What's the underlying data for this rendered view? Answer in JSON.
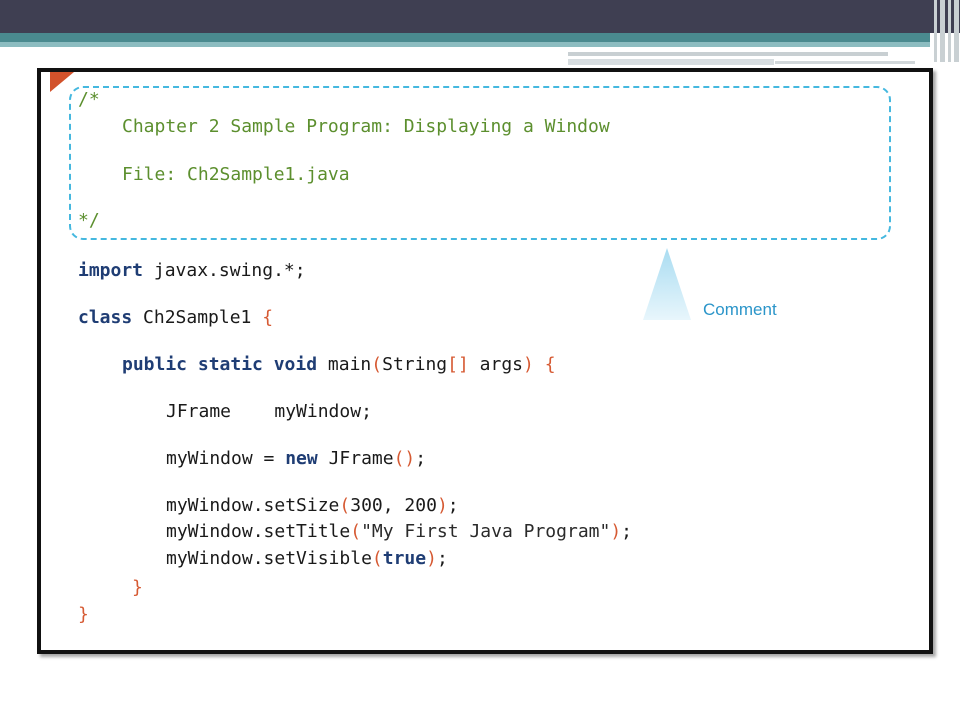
{
  "slide": {
    "colors": {
      "top_bar": "#3f3f52",
      "accent_band": "#4a8a8f",
      "corner_tab": "#d2522b",
      "comment_border": "#45b8df",
      "comment_text": "#5c8f2e",
      "keyword": "#1f3d74",
      "bracket": "#d65a33"
    }
  },
  "figure": {
    "comment_box": {
      "open": "/*",
      "line1": "Chapter 2 Sample Program: Displaying a Window",
      "line2": "File: Ch2Sample1.java",
      "close": "*/"
    },
    "callout": {
      "label": "Comment"
    },
    "code": {
      "import_kw": "import",
      "import_rest": " javax.swing.*;",
      "class_kw": "class",
      "class_name": " Ch2Sample1 ",
      "class_open": "{",
      "main_kw": "public static void",
      "main_name": " main",
      "main_paren_open": "(",
      "main_params_type": "String",
      "main_brackets": "[]",
      "main_params_name": " args",
      "main_paren_close": ")",
      "main_open": " {",
      "decl": "JFrame    myWindow;",
      "assign_left": "myWindow = ",
      "assign_new": "new",
      "assign_right": " JFrame",
      "assign_parens": "()",
      "assign_end": ";",
      "setsize_call": "myWindow.setSize",
      "setsize_open": "(",
      "setsize_args": "300, 200",
      "setsize_close": ")",
      "setsize_end": ";",
      "settitle_call": "myWindow.setTitle",
      "settitle_open": "(",
      "settitle_arg": "\"My First Java Program\"",
      "settitle_close": ")",
      "settitle_end": ";",
      "setvisible_call": "myWindow.setVisible",
      "setvisible_open": "(",
      "setvisible_arg": "true",
      "setvisible_close": ")",
      "setvisible_end": ";",
      "main_close": "}",
      "class_close": "}"
    }
  }
}
